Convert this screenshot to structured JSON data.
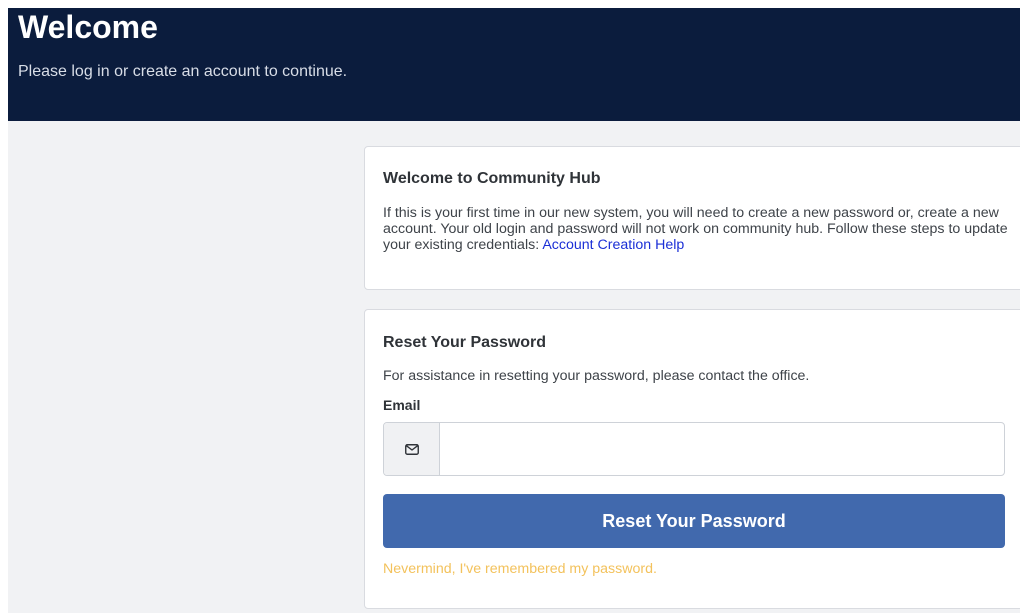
{
  "header": {
    "title": "Welcome",
    "subtitle": "Please log in or create an account to continue."
  },
  "welcome_card": {
    "title": "Welcome to Community Hub",
    "body_text": "If this is your first time in our new system, you will need to create a new password or, create a new account. Your old login and password will not work on community hub. Follow these steps to update your existing credentials: ",
    "help_link": "Account Creation Help"
  },
  "reset_card": {
    "title": "Reset Your Password",
    "description": "For assistance in resetting your password, please contact the office.",
    "email_label": "Email",
    "email_value": "",
    "email_icon": "envelope-icon",
    "submit_label": "Reset Your Password",
    "nevermind_link": "Nevermind, I've remembered my password."
  },
  "colors": {
    "header_bg": "#0b1c3d",
    "button_bg": "#4169ad",
    "link_blue": "#1b2fd6",
    "link_yellow": "#f3c25c",
    "page_bg": "#f1f2f4"
  }
}
